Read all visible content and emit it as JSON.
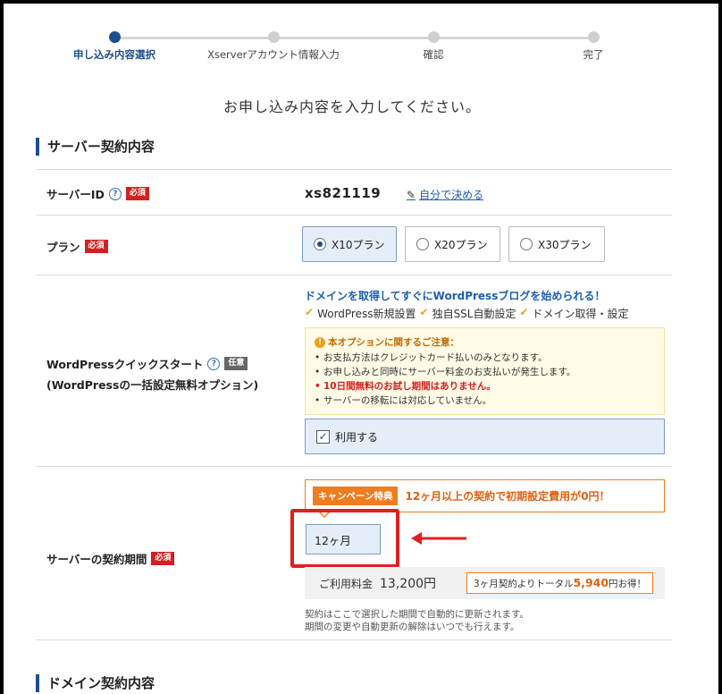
{
  "stepper": {
    "steps": [
      {
        "label": "申し込み内容選択"
      },
      {
        "label": "Xserverアカウント情報入力"
      },
      {
        "label": "確認"
      },
      {
        "label": "完了"
      }
    ]
  },
  "lead": "お申し込み内容を入力してください。",
  "server_section": {
    "title": "サーバー契約内容",
    "server_id": {
      "label": "サーバーID",
      "badge": "必須",
      "value": "xs821119",
      "edit_link": "自分で決める"
    },
    "plan": {
      "label": "プラン",
      "badge": "必須",
      "options": [
        "X10プラン",
        "X20プラン",
        "X30プラン"
      ],
      "selected": "X10プラン"
    },
    "wordpress": {
      "label_line1": "WordPressクイックスタート",
      "label_line2": "(WordPressの一括設定無料オプション)",
      "badge": "任意",
      "headline": "ドメインを取得してすぐにWordPressブログを始められる！",
      "features": [
        "WordPress新規設置",
        "独自SSL自動設定",
        "ドメイン取得・設定"
      ],
      "notice_title": "本オプションに関するご注意：",
      "notices": [
        "お支払方法はクレジットカード払いのみとなります。",
        "お申し込みと同時にサーバー料金のお支払いが発生します。",
        "10日間無料のお試し期間はありません。",
        "サーバーの移転には対応していません。"
      ],
      "use_label": "利用する",
      "use_checked": true
    },
    "period": {
      "label": "サーバーの契約期間",
      "badge": "必須",
      "campaign_tag": "キャンペーン特典",
      "campaign_text": "12ヶ月以上の契約で初期設定費用が0円！",
      "selected": "12ヶ月",
      "fee_label": "ご利用料金",
      "fee_amount": "13,200円",
      "saving_prefix": "3ヶ月契約よりトータル",
      "saving_amount": "5,940",
      "saving_suffix": "円お得！",
      "note_line1": "契約はここで選択した期間で自動的に更新されます。",
      "note_line2": "期間の変更や自動更新の解除はいつでも行えます。"
    }
  },
  "domain_section": {
    "title": "ドメイン契約内容"
  },
  "colors": {
    "accent": "#1c4f8f",
    "required": "#d41f1f",
    "campaign": "#f07c20",
    "highlight": "#e02020"
  }
}
